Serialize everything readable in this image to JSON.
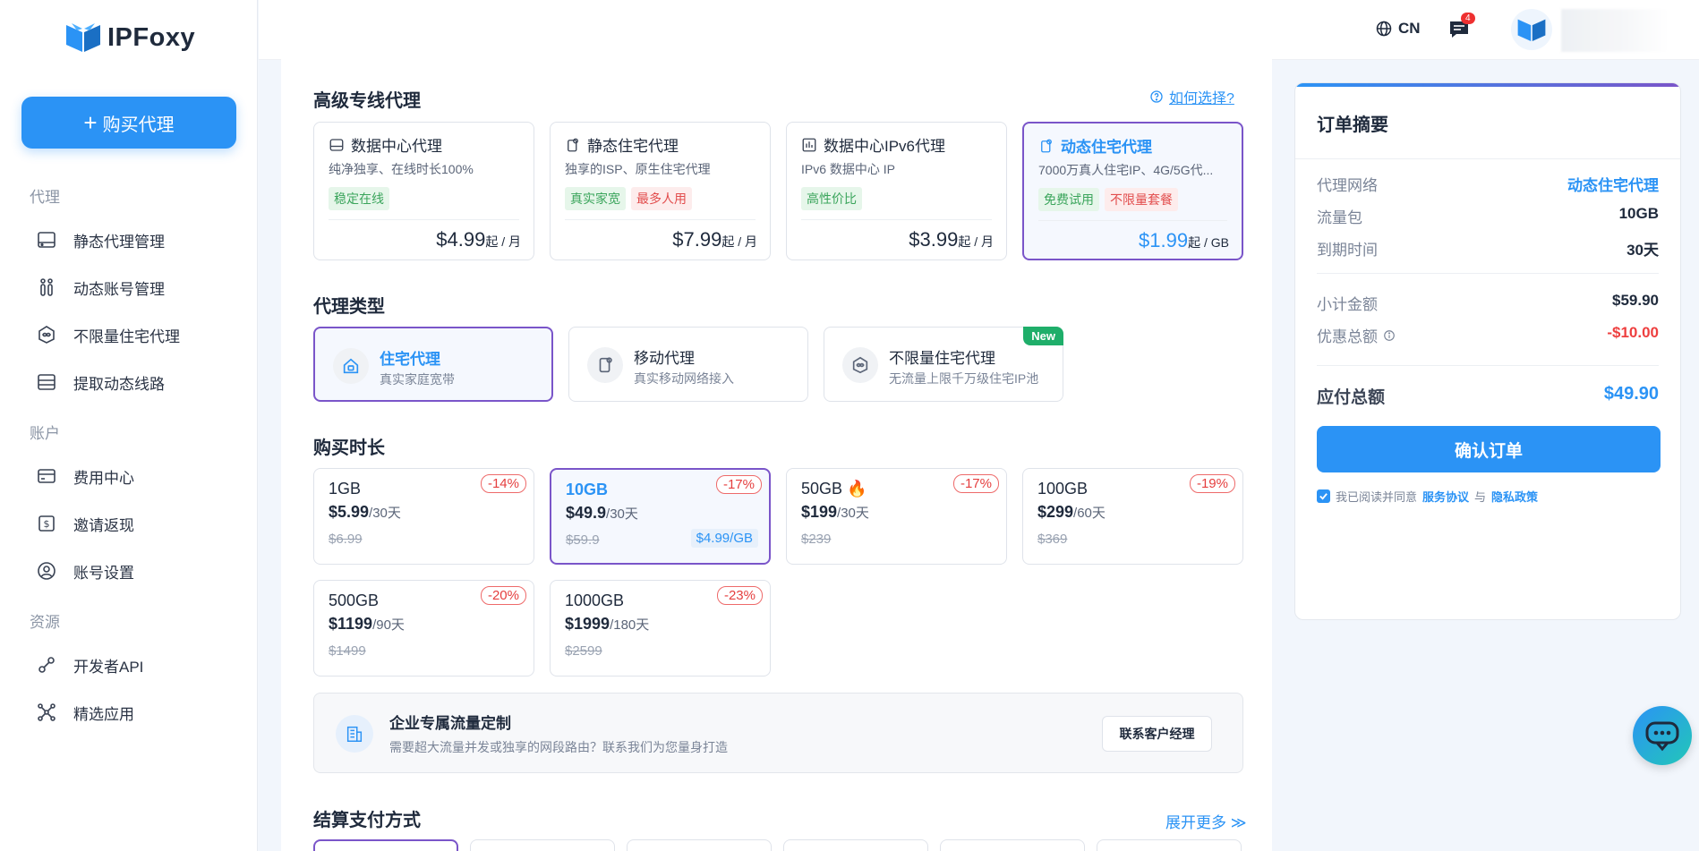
{
  "app": {
    "logo_text": "IPFoxy"
  },
  "sidebar": {
    "buy_label": "购买代理",
    "sections": [
      {
        "title": "代理",
        "items": [
          {
            "label": "静态代理管理",
            "icon": "server-icon"
          },
          {
            "label": "动态账号管理",
            "icon": "users-icon"
          },
          {
            "label": "不限量住宅代理",
            "icon": "infinity-shield-icon"
          },
          {
            "label": "提取动态线路",
            "icon": "list-extract-icon"
          }
        ]
      },
      {
        "title": "账户",
        "items": [
          {
            "label": "费用中心",
            "icon": "card-icon"
          },
          {
            "label": "邀请返现",
            "icon": "dollar-icon"
          },
          {
            "label": "账号设置",
            "icon": "user-circle-icon"
          }
        ]
      },
      {
        "title": "资源",
        "items": [
          {
            "label": "开发者API",
            "icon": "api-plug-icon"
          },
          {
            "label": "精选应用",
            "icon": "apps-network-icon"
          }
        ]
      }
    ]
  },
  "topbar": {
    "lang": "CN",
    "msg_count": "4"
  },
  "proxy_section": {
    "title": "高级专线代理",
    "help_link": "如何选择?",
    "cards": [
      {
        "title": "数据中心代理",
        "desc": "纯净独享、在线时长100%",
        "tags": [
          "稳定在线"
        ],
        "price": "$4.99",
        "unit": "起 / 月"
      },
      {
        "title": "静态住宅代理",
        "desc": "独享的ISP、原生住宅代理",
        "tags": [
          "真实家宽",
          "最多人用"
        ],
        "price": "$7.99",
        "unit": "起 / 月"
      },
      {
        "title": "数据中心IPv6代理",
        "desc": "IPv6 数据中心 IP",
        "tags": [
          "高性价比"
        ],
        "price": "$3.99",
        "unit": "起 / 月"
      },
      {
        "title": "动态住宅代理",
        "desc": "7000万真人住宅IP、4G/5G代...",
        "tags": [
          "免费试用",
          "不限量套餐"
        ],
        "price": "$1.99",
        "unit": "起 / GB"
      }
    ]
  },
  "type_section": {
    "title": "代理类型",
    "cards": [
      {
        "title": "住宅代理",
        "desc": "真实家庭宽带"
      },
      {
        "title": "移动代理",
        "desc": "真实移动网络接入"
      },
      {
        "title": "不限量住宅代理",
        "desc": "无流量上限千万级住宅IP池",
        "badge": "New"
      }
    ]
  },
  "duration_section": {
    "title": "购买时长",
    "cards": [
      {
        "name": "1GB",
        "price": "$5.99",
        "period": "/30天",
        "orig": "$6.99",
        "discount": "-14%"
      },
      {
        "name": "10GB",
        "price": "$49.9",
        "period": "/30天",
        "orig": "$59.9",
        "discount": "-17%",
        "unit_price": "$4.99/GB"
      },
      {
        "name": "50GB 🔥",
        "price": "$199",
        "period": "/30天",
        "orig": "$239",
        "discount": "-17%"
      },
      {
        "name": "100GB",
        "price": "$299",
        "period": "/60天",
        "orig": "$369",
        "discount": "-19%"
      },
      {
        "name": "500GB",
        "price": "$1199",
        "period": "/90天",
        "orig": "$1499",
        "discount": "-20%"
      },
      {
        "name": "1000GB",
        "price": "$1999",
        "period": "/180天",
        "orig": "$2599",
        "discount": "-23%"
      }
    ]
  },
  "enterprise": {
    "title": "企业专属流量定制",
    "desc": "需要超大流量并发或独享的网段路由？联系我们为您量身打造",
    "button": "联系客户经理"
  },
  "payment": {
    "title": "结算支付方式",
    "more": "展开更多 ≫"
  },
  "summary": {
    "title": "订单摘要",
    "rows": [
      {
        "k": "代理网络",
        "v": "动态住宅代理"
      },
      {
        "k": "流量包",
        "v": "10GB"
      },
      {
        "k": "到期时间",
        "v": "30天"
      },
      {
        "k": "小计金额",
        "v": "$59.90"
      },
      {
        "k": "优惠总额",
        "v": "-$10.00"
      },
      {
        "k": "应付总额",
        "v": "$49.90"
      }
    ],
    "confirm": "确认订单",
    "agree_text": "我已阅读并同意",
    "tos": "服务协议",
    "and": "与",
    "privacy": "隐私政策"
  },
  "colors": {
    "accent": "#2b93f5",
    "selected_border": "#7a55c9",
    "discount": "#e53e3e",
    "tag_green": "#3ba55c"
  }
}
